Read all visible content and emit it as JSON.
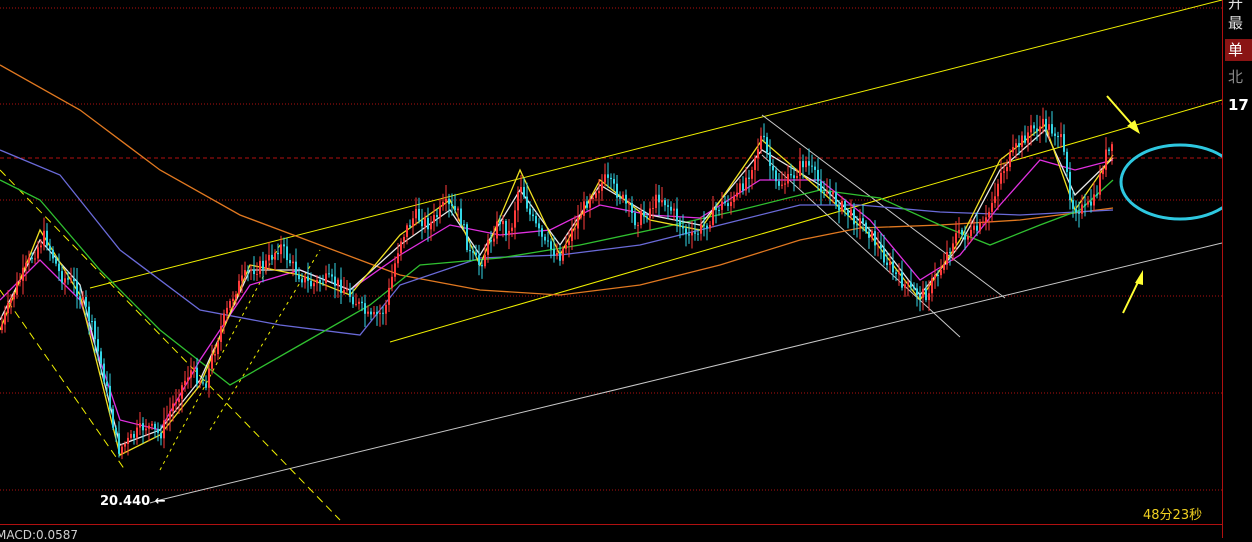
{
  "chart_data": {
    "type": "candlestick",
    "low_price_label": "20.440",
    "indicators": [
      "MA5",
      "MA10",
      "MA20",
      "MA60",
      "MA120",
      "MA250"
    ],
    "grid": true,
    "colors": {
      "background": "#000000",
      "grid": "#b01010",
      "up": "#ff3b3b",
      "down": "#33d6e6",
      "channel": "#f0f000",
      "support": "#c8c8c8",
      "ellipse": "#2ec8e0",
      "arrows": "#ffff33"
    }
  },
  "sidebar": {
    "line1": "开",
    "line2": "最",
    "button": "单",
    "region": "北",
    "value": "17"
  },
  "footer": {
    "timer": "48分23秒",
    "macd": "MACD:0.0587"
  }
}
